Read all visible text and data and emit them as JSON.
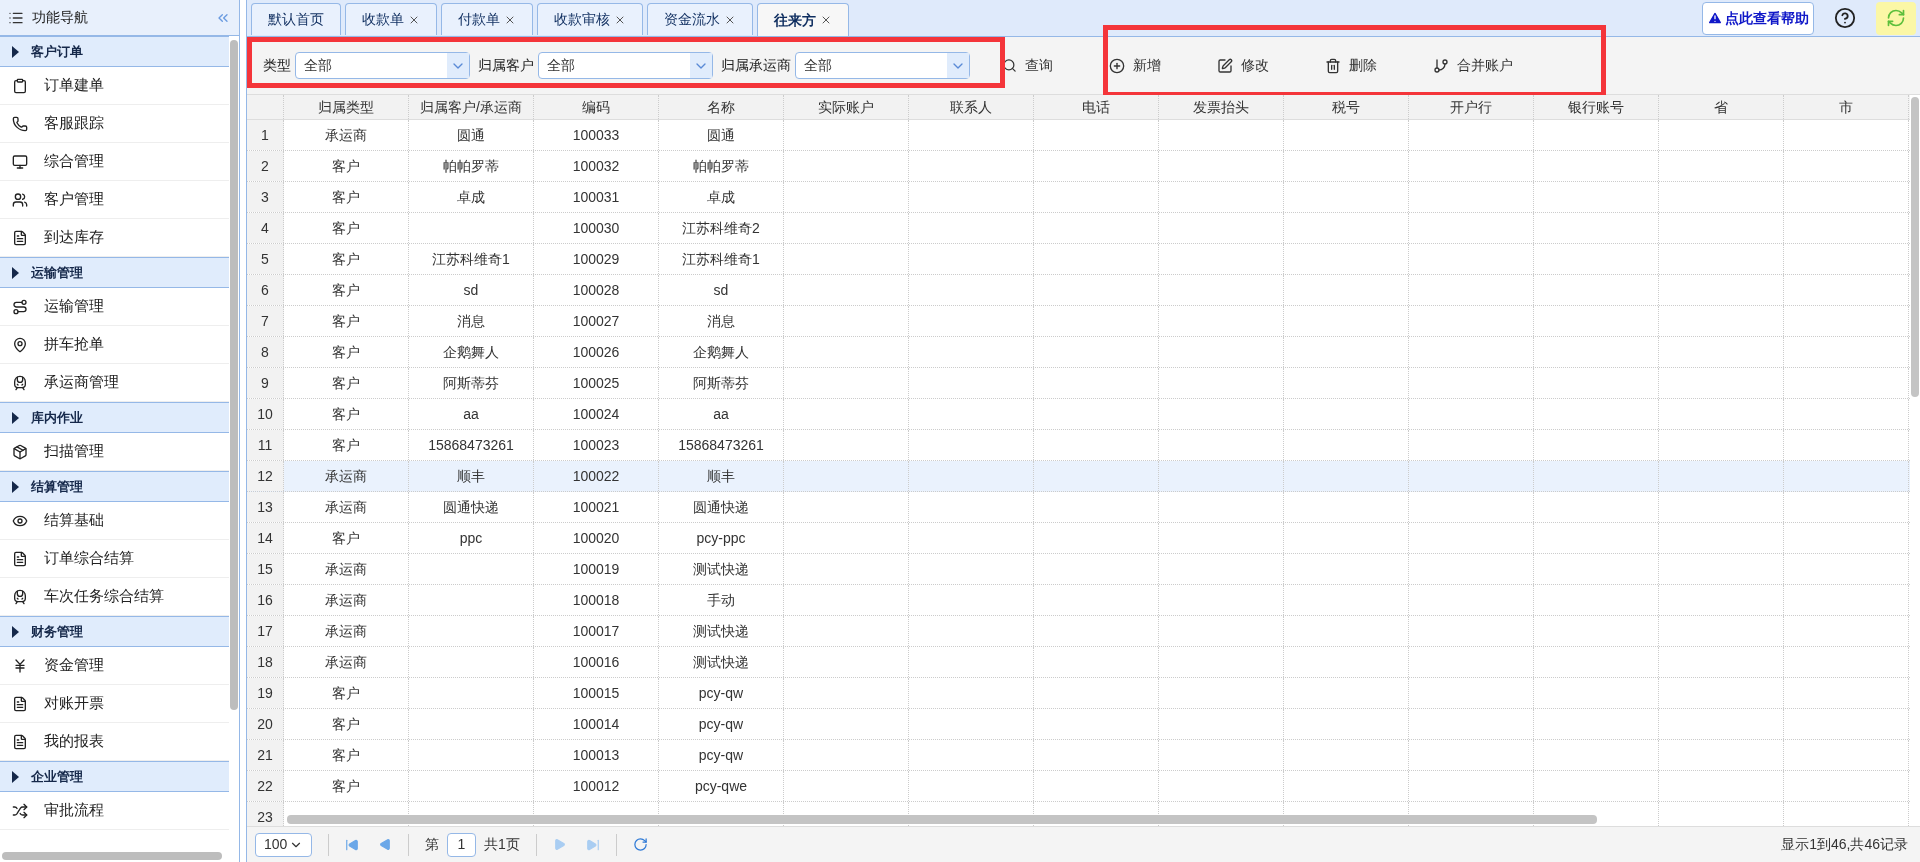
{
  "sidebar": {
    "title": "功能导航",
    "groups": [
      {
        "label": "客户订单",
        "items": [
          {
            "label": "订单建单"
          },
          {
            "label": "客服跟踪"
          },
          {
            "label": "综合管理"
          },
          {
            "label": "客户管理"
          },
          {
            "label": "到达库存"
          }
        ]
      },
      {
        "label": "运输管理",
        "items": [
          {
            "label": "运输管理"
          },
          {
            "label": "拼车抢单"
          },
          {
            "label": "承运商管理"
          }
        ]
      },
      {
        "label": "库内作业",
        "items": [
          {
            "label": "扫描管理"
          }
        ]
      },
      {
        "label": "结算管理",
        "items": [
          {
            "label": "结算基础"
          },
          {
            "label": "订单综合结算"
          },
          {
            "label": "车次任务综合结算"
          }
        ]
      },
      {
        "label": "财务管理",
        "items": [
          {
            "label": "资金管理"
          },
          {
            "label": "对账开票"
          },
          {
            "label": "我的报表"
          }
        ]
      },
      {
        "label": "企业管理",
        "items": [
          {
            "label": "审批流程"
          }
        ]
      }
    ]
  },
  "tabs": [
    {
      "label": "默认首页",
      "selected": false,
      "closable": false
    },
    {
      "label": "收款单",
      "selected": false,
      "closable": true
    },
    {
      "label": "付款单",
      "selected": false,
      "closable": true
    },
    {
      "label": "收款审核",
      "selected": false,
      "closable": true
    },
    {
      "label": "资金流水",
      "selected": false,
      "closable": true
    },
    {
      "label": "往来方",
      "selected": true,
      "closable": true
    }
  ],
  "help": {
    "label": "点此查看帮助"
  },
  "filters": [
    {
      "label": "类型",
      "value": "全部"
    },
    {
      "label": "归属客户",
      "value": "全部"
    },
    {
      "label": "归属承运商",
      "value": "全部"
    }
  ],
  "search_button": "查询",
  "actions": [
    {
      "kind": "add",
      "label": "新增"
    },
    {
      "kind": "edit",
      "label": "修改"
    },
    {
      "kind": "delete",
      "label": "删除"
    },
    {
      "kind": "merge",
      "label": "合并账户"
    }
  ],
  "table": {
    "columns": [
      "归属类型",
      "归属客户/承运商",
      "编码",
      "名称",
      "实际账户",
      "联系人",
      "电话",
      "发票抬头",
      "税号",
      "开户行",
      "银行账号",
      "省",
      "市"
    ],
    "rows": [
      {
        "no": "1",
        "selected": false,
        "cells": [
          "承运商",
          "圆通",
          "100033",
          "圆通"
        ]
      },
      {
        "no": "2",
        "selected": false,
        "cells": [
          "客户",
          "帕帕罗蒂",
          "100032",
          "帕帕罗蒂"
        ]
      },
      {
        "no": "3",
        "selected": false,
        "cells": [
          "客户",
          "卓成",
          "100031",
          "卓成"
        ]
      },
      {
        "no": "4",
        "selected": false,
        "cells": [
          "客户",
          "",
          "100030",
          "江苏科维奇2"
        ]
      },
      {
        "no": "5",
        "selected": false,
        "cells": [
          "客户",
          "江苏科维奇1",
          "100029",
          "江苏科维奇1"
        ]
      },
      {
        "no": "6",
        "selected": false,
        "cells": [
          "客户",
          "sd",
          "100028",
          "sd"
        ]
      },
      {
        "no": "7",
        "selected": false,
        "cells": [
          "客户",
          "消息",
          "100027",
          "消息"
        ]
      },
      {
        "no": "8",
        "selected": false,
        "cells": [
          "客户",
          "企鹅舞人",
          "100026",
          "企鹅舞人"
        ]
      },
      {
        "no": "9",
        "selected": false,
        "cells": [
          "客户",
          "阿斯蒂芬",
          "100025",
          "阿斯蒂芬"
        ]
      },
      {
        "no": "10",
        "selected": false,
        "cells": [
          "客户",
          "aa",
          "100024",
          "aa"
        ]
      },
      {
        "no": "11",
        "selected": false,
        "cells": [
          "客户",
          "15868473261",
          "100023",
          "15868473261"
        ]
      },
      {
        "no": "12",
        "selected": true,
        "cells": [
          "承运商",
          "顺丰",
          "100022",
          "顺丰"
        ]
      },
      {
        "no": "13",
        "selected": false,
        "cells": [
          "承运商",
          "圆通快递",
          "100021",
          "圆通快递"
        ]
      },
      {
        "no": "14",
        "selected": false,
        "cells": [
          "客户",
          "ppc",
          "100020",
          "pcy-ppc"
        ]
      },
      {
        "no": "15",
        "selected": false,
        "cells": [
          "承运商",
          "",
          "100019",
          "测试快递"
        ]
      },
      {
        "no": "16",
        "selected": false,
        "cells": [
          "承运商",
          "",
          "100018",
          "手动"
        ]
      },
      {
        "no": "17",
        "selected": false,
        "cells": [
          "承运商",
          "",
          "100017",
          "测试快递"
        ]
      },
      {
        "no": "18",
        "selected": false,
        "cells": [
          "承运商",
          "",
          "100016",
          "测试快递"
        ]
      },
      {
        "no": "19",
        "selected": false,
        "cells": [
          "客户",
          "",
          "100015",
          "pcy-qw"
        ]
      },
      {
        "no": "20",
        "selected": false,
        "cells": [
          "客户",
          "",
          "100014",
          "pcy-qw"
        ]
      },
      {
        "no": "21",
        "selected": false,
        "cells": [
          "客户",
          "",
          "100013",
          "pcy-qw"
        ]
      },
      {
        "no": "22",
        "selected": false,
        "cells": [
          "客户",
          "",
          "100012",
          "pcy-qwe"
        ]
      },
      {
        "no": "23",
        "selected": false
      }
    ]
  },
  "pager": {
    "page_size": "100",
    "page_prefix": "第",
    "page": "1",
    "page_total": "共1页",
    "summary": "显示1到46,共46记录"
  }
}
